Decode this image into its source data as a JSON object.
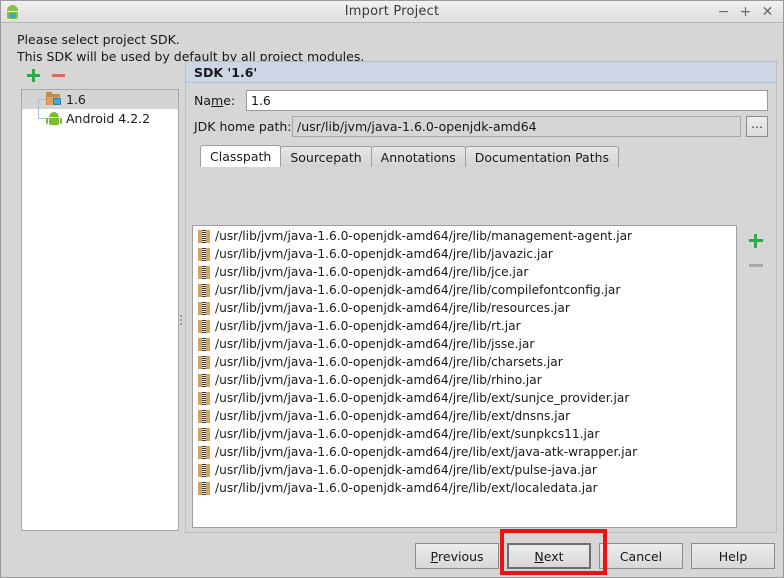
{
  "window": {
    "title": "Import Project",
    "app_icon": "android-robot-icon",
    "controls": {
      "minimize": "−",
      "maximize": "+",
      "close": "✕"
    }
  },
  "prompt": {
    "line1": "Please select project SDK.",
    "line2": "This SDK will be used by default by all project modules."
  },
  "sidebar": {
    "add_label": "add-sdk",
    "remove_label": "remove-sdk",
    "items": [
      {
        "label": "1.6",
        "icon": "jdk-folder-icon",
        "selected": true
      },
      {
        "label": "Android 4.2.2",
        "icon": "android-icon",
        "selected": false
      }
    ]
  },
  "detail": {
    "header": "SDK '1.6'",
    "name_label_pre": "Na",
    "name_label_mn": "m",
    "name_label_post": "e:",
    "name_value": "1.6",
    "jdk_label": "JDK home path:",
    "jdk_value": "/usr/lib/jvm/java-1.6.0-openjdk-amd64",
    "browse_label": "…",
    "tabs": [
      {
        "label": "Classpath",
        "active": true
      },
      {
        "label": "Sourcepath",
        "active": false
      },
      {
        "label": "Annotations",
        "active": false
      },
      {
        "label": "Documentation Paths",
        "active": false
      }
    ],
    "classpath_entries": [
      "/usr/lib/jvm/java-1.6.0-openjdk-amd64/jre/lib/management-agent.jar",
      "/usr/lib/jvm/java-1.6.0-openjdk-amd64/jre/lib/javazic.jar",
      "/usr/lib/jvm/java-1.6.0-openjdk-amd64/jre/lib/jce.jar",
      "/usr/lib/jvm/java-1.6.0-openjdk-amd64/jre/lib/compilefontconfig.jar",
      "/usr/lib/jvm/java-1.6.0-openjdk-amd64/jre/lib/resources.jar",
      "/usr/lib/jvm/java-1.6.0-openjdk-amd64/jre/lib/rt.jar",
      "/usr/lib/jvm/java-1.6.0-openjdk-amd64/jre/lib/jsse.jar",
      "/usr/lib/jvm/java-1.6.0-openjdk-amd64/jre/lib/charsets.jar",
      "/usr/lib/jvm/java-1.6.0-openjdk-amd64/jre/lib/rhino.jar",
      "/usr/lib/jvm/java-1.6.0-openjdk-amd64/jre/lib/ext/sunjce_provider.jar",
      "/usr/lib/jvm/java-1.6.0-openjdk-amd64/jre/lib/ext/dnsns.jar",
      "/usr/lib/jvm/java-1.6.0-openjdk-amd64/jre/lib/ext/sunpkcs11.jar",
      "/usr/lib/jvm/java-1.6.0-openjdk-amd64/jre/lib/ext/java-atk-wrapper.jar",
      "/usr/lib/jvm/java-1.6.0-openjdk-amd64/jre/lib/ext/pulse-java.jar",
      "/usr/lib/jvm/java-1.6.0-openjdk-amd64/jre/lib/ext/localedata.jar"
    ],
    "classpath_add": "add-classpath-entry",
    "classpath_remove": "remove-classpath-entry"
  },
  "buttons": {
    "previous": {
      "pre": "",
      "mn": "P",
      "post": "revious"
    },
    "next": {
      "pre": "",
      "mn": "N",
      "post": "ext",
      "focused": true
    },
    "cancel": {
      "pre": "Cancel",
      "mn": "",
      "post": ""
    },
    "help": {
      "pre": "Help",
      "mn": "",
      "post": ""
    }
  },
  "annotation": {
    "color": "#ee1111",
    "target": "next-button"
  },
  "colors": {
    "dialog_bg": "#d6d6d6",
    "header_bg": "#ccd6e4",
    "list_bg": "#ffffff",
    "accent_green": "#2eaa4a",
    "accent_red": "#d96a62",
    "annotation_red": "#ee1111"
  }
}
